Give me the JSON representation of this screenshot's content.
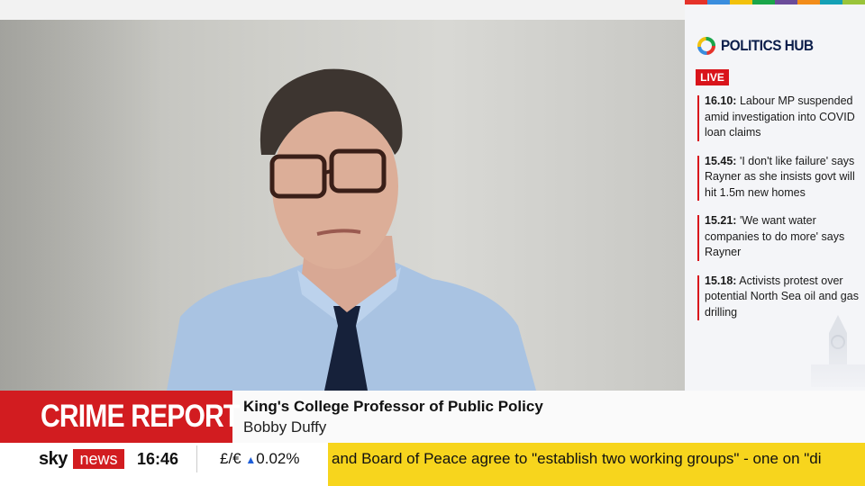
{
  "video": {
    "speaker_description_icon": "presenter-video"
  },
  "politics_hub": {
    "title": "POLITICS HUB",
    "live_label": "LIVE",
    "colors": [
      "#e5332a",
      "#3a8dde",
      "#f2c10c",
      "#1aa64a",
      "#6b4c9a",
      "#f28c1a",
      "#14a0b5",
      "#9ac43a"
    ],
    "items": [
      {
        "time": "16.10:",
        "text": "Labour MP suspended amid investigation into COVID loan claims"
      },
      {
        "time": "15.45:",
        "text": "'I don't like failure' says Rayner as she insists govt will hit 1.5m new homes"
      },
      {
        "time": "15.21:",
        "text": "'We want water companies to do more' says Rayner"
      },
      {
        "time": "15.18:",
        "text": "Activists protest over potential North Sea oil and gas drilling"
      }
    ]
  },
  "lower_third": {
    "category": "CRIME REPORT",
    "headline": "King's College Professor of Public Policy",
    "name": "Bobby Duffy"
  },
  "ticker": {
    "brand_sky": "sky",
    "brand_news": "news",
    "time": "16:46",
    "market_label": "£/€",
    "market_arrow": "▲",
    "market_value": "0.02%",
    "scroll_text": "and Board of Peace agree to \"establish two working groups\" - one on \"di"
  },
  "accent_colors": {
    "brand_red": "#d21c20",
    "ticker_yellow": "#f7d51d",
    "hub_navy": "#0a1d4a"
  }
}
